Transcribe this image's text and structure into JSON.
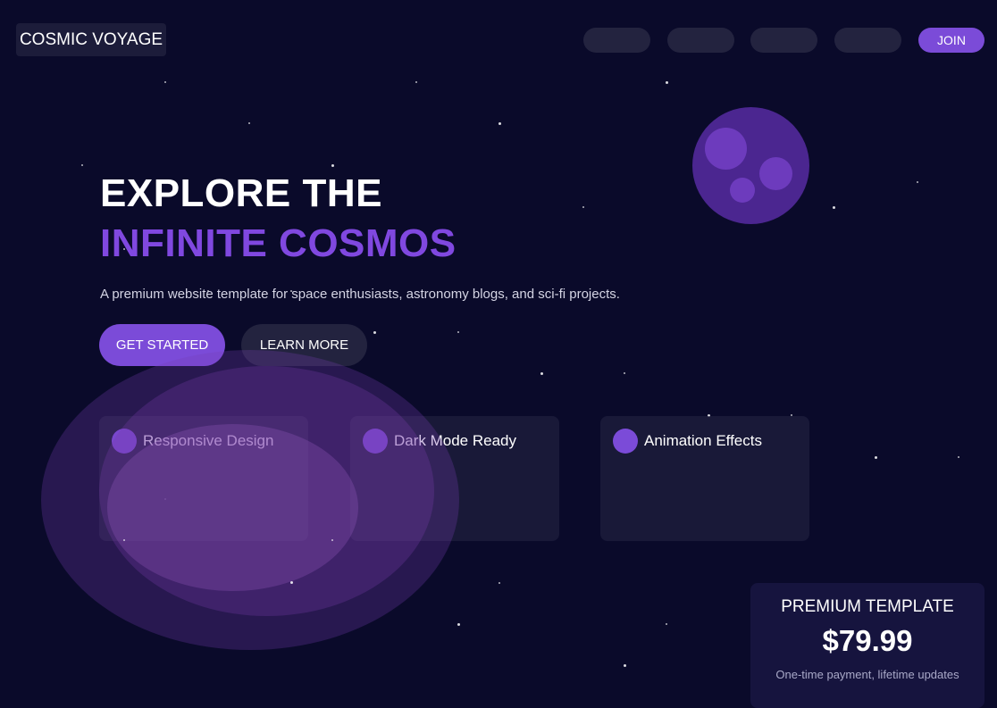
{
  "header": {
    "logo_text": "COSMIC VOYAGE",
    "nav_items": [
      "",
      "",
      "",
      ""
    ],
    "join_label": "JOIN"
  },
  "hero": {
    "title_line1": "EXPLORE THE",
    "title_line2": "INFINITE COSMOS",
    "subtitle": "A premium website template for space enthusiasts, astronomy blogs, and sci-fi projects.",
    "primary_button": "GET STARTED",
    "secondary_button": "LEARN MORE"
  },
  "features": [
    {
      "title": "Responsive Design"
    },
    {
      "title": "Dark Mode Ready"
    },
    {
      "title": "Animation Effects"
    }
  ],
  "pricing": {
    "heading": "PREMIUM TEMPLATE",
    "price": "$79.99",
    "note": "One-time payment, lifetime updates"
  },
  "colors": {
    "background": "#0a0a2a",
    "accent": "#7b4bd8",
    "accent_text": "#8048e0",
    "planet": "#4b2690",
    "card": "#222240",
    "pricing_panel": "#16143e"
  }
}
